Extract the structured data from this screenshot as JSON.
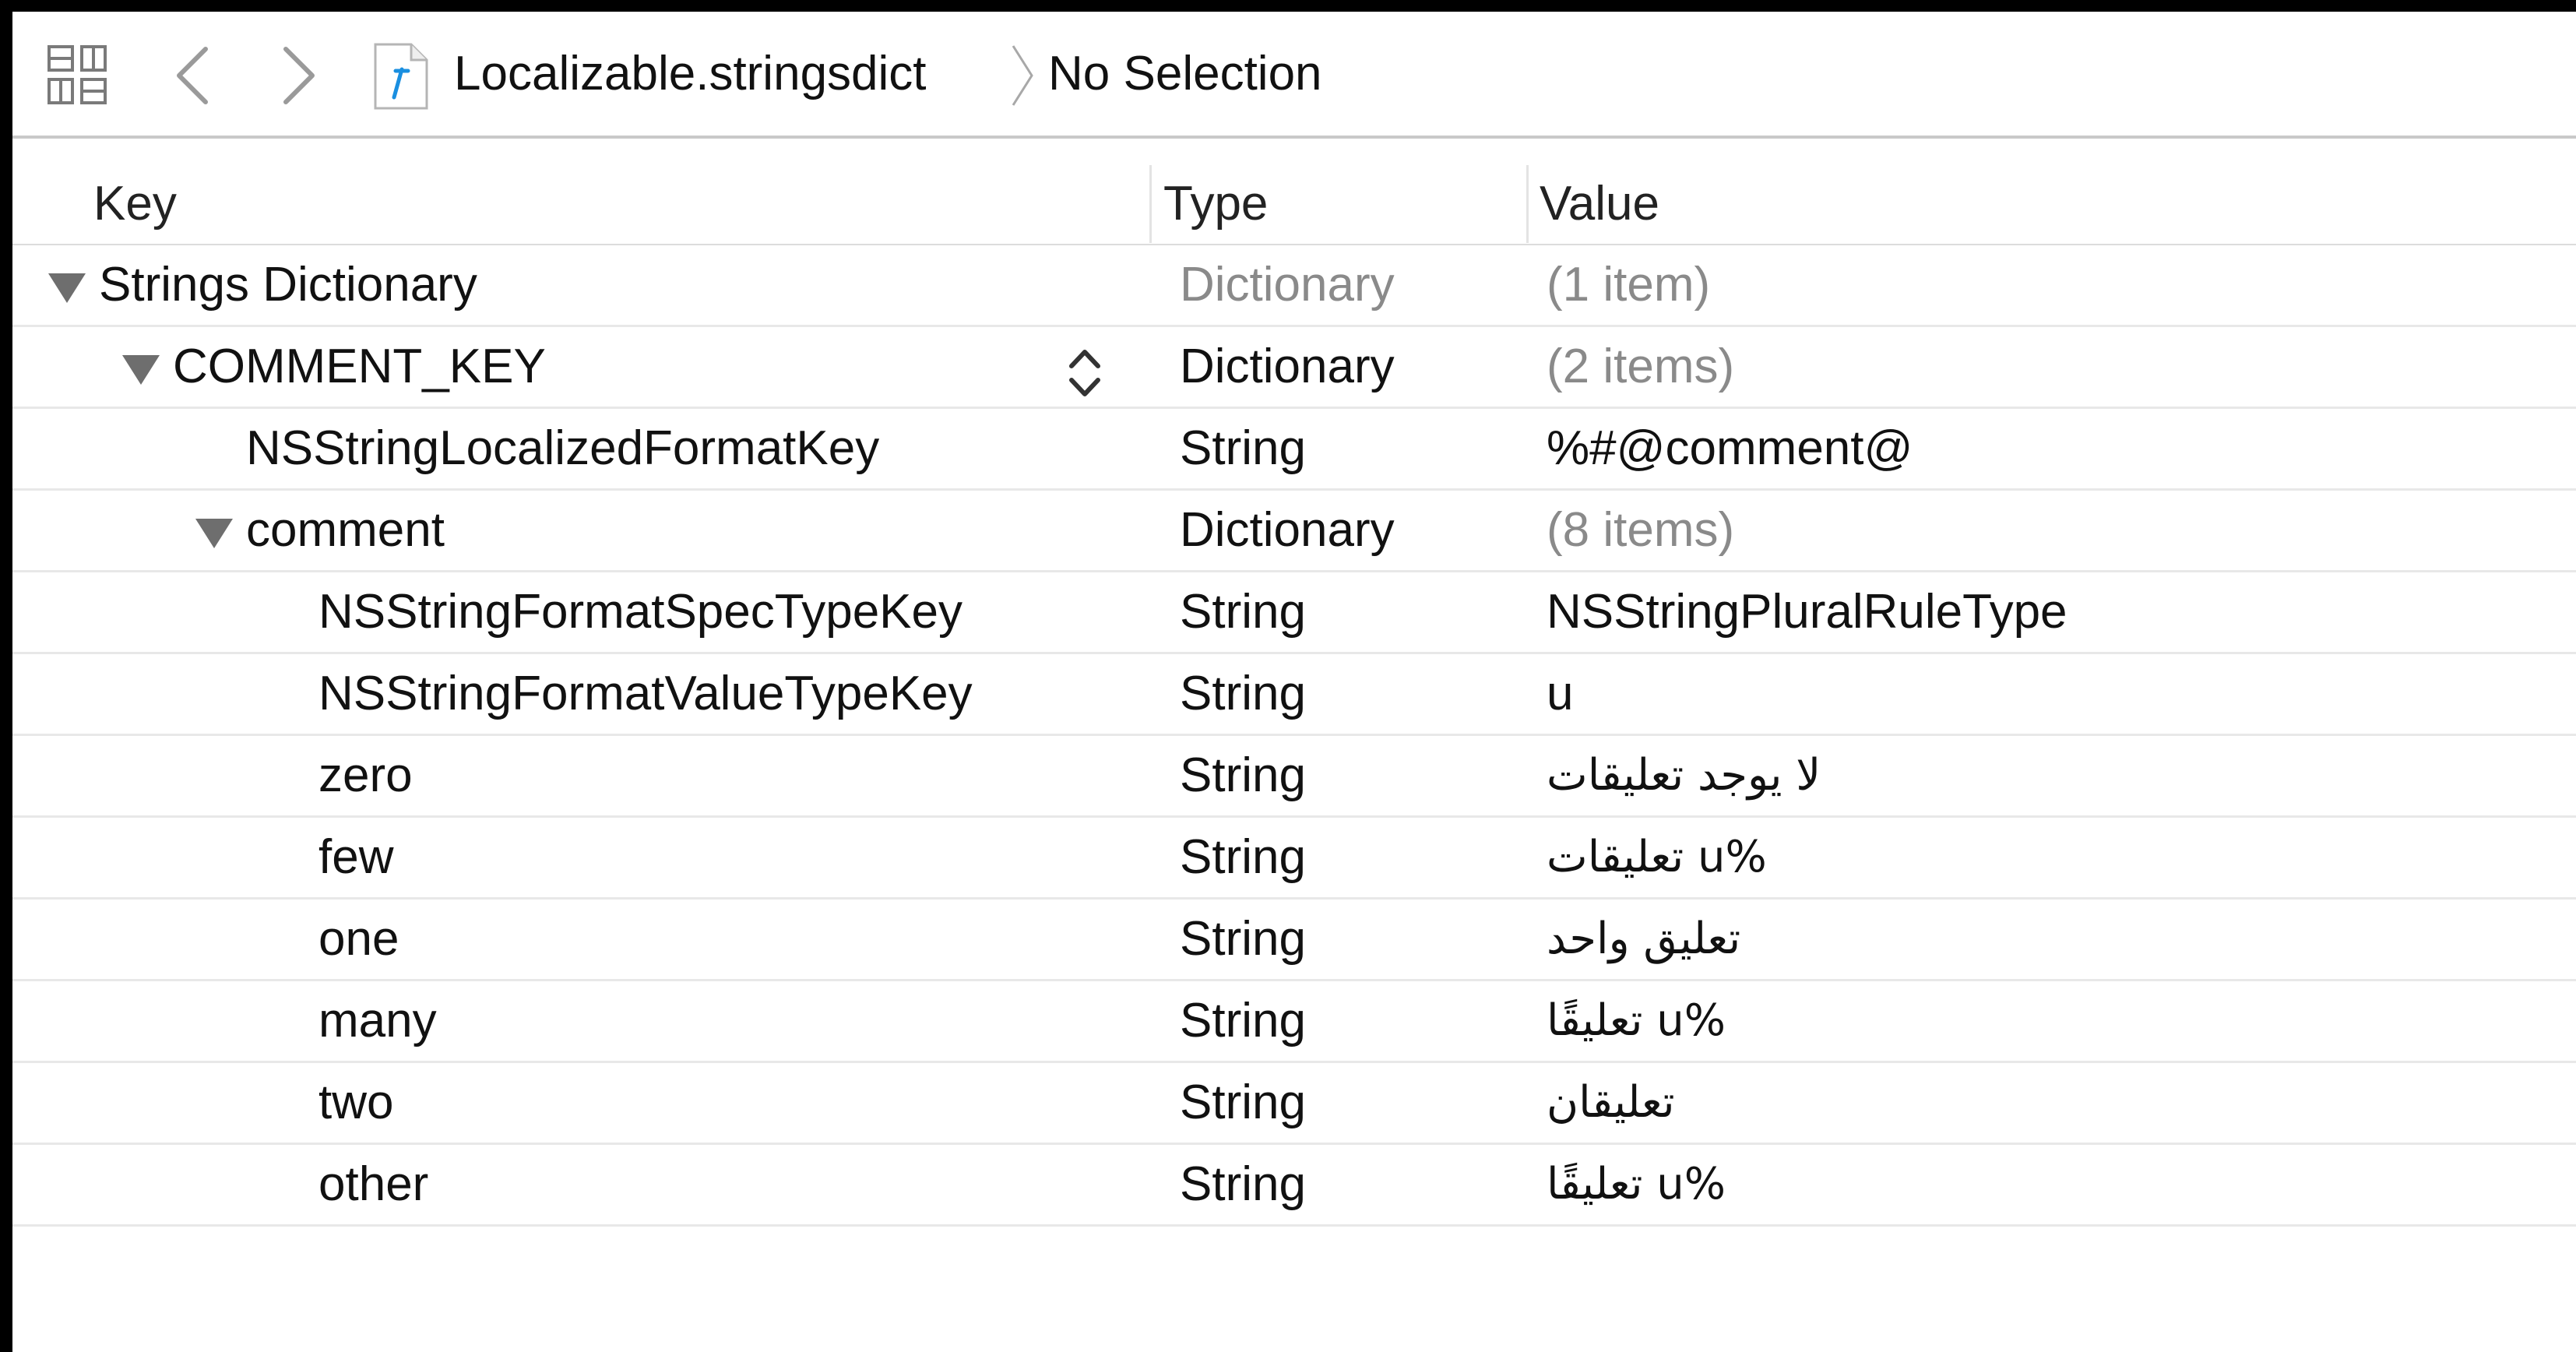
{
  "jump_bar": {
    "file_name": "Localizable.stringsdict",
    "selection": "No Selection"
  },
  "table": {
    "headers": {
      "key": "Key",
      "type": "Type",
      "value": "Value"
    },
    "rows": [
      {
        "key": "Strings Dictionary",
        "type": "Dictionary",
        "value": "(1 item)",
        "level": 0,
        "expanded": true,
        "dim_type": true,
        "dim_value": true
      },
      {
        "key": "COMMENT_KEY",
        "type": "Dictionary",
        "value": "(2 items)",
        "level": 1,
        "expanded": true,
        "dim_type": false,
        "dim_value": true
      },
      {
        "key": "NSStringLocalizedFormatKey",
        "type": "String",
        "value": "%#@comment@",
        "level": 2,
        "expanded": null
      },
      {
        "key": "comment",
        "type": "Dictionary",
        "value": "(8 items)",
        "level": 2,
        "expanded": true,
        "dim_type": false,
        "dim_value": true
      },
      {
        "key": "NSStringFormatSpecTypeKey",
        "type": "String",
        "value": "NSStringPluralRuleType",
        "level": 3
      },
      {
        "key": "NSStringFormatValueTypeKey",
        "type": "String",
        "value": "u",
        "level": 3
      },
      {
        "key": "zero",
        "type": "String",
        "value": "لا يوجد تعليقات",
        "level": 3,
        "arabic": true
      },
      {
        "key": "few",
        "type": "String",
        "value": "%u تعليقات",
        "level": 3,
        "arabic": true
      },
      {
        "key": "one",
        "type": "String",
        "value": "تعليق واحد",
        "level": 3,
        "arabic": true
      },
      {
        "key": "many",
        "type": "String",
        "value": "%u تعليقًا",
        "level": 3,
        "arabic": true
      },
      {
        "key": "two",
        "type": "String",
        "value": "تعليقان",
        "level": 3,
        "arabic": true
      },
      {
        "key": "other",
        "type": "String",
        "value": "%u تعليقًا",
        "level": 3,
        "arabic": true
      }
    ]
  },
  "colors": {
    "background": "#000000",
    "panel": "#ffffff",
    "dim_text": "#8a8a8a",
    "text": "#111111",
    "link_icon": "#1a8fe0"
  },
  "icons": {
    "grid": "related-items-grid-icon",
    "back": "chevron-left-icon",
    "forward": "chevron-right-icon",
    "file": "stringsdict-file-icon",
    "separator": "breadcrumb-chevron-icon",
    "stepper": "up-down-stepper-icon",
    "disclosure": "disclosure-triangle-icon"
  }
}
